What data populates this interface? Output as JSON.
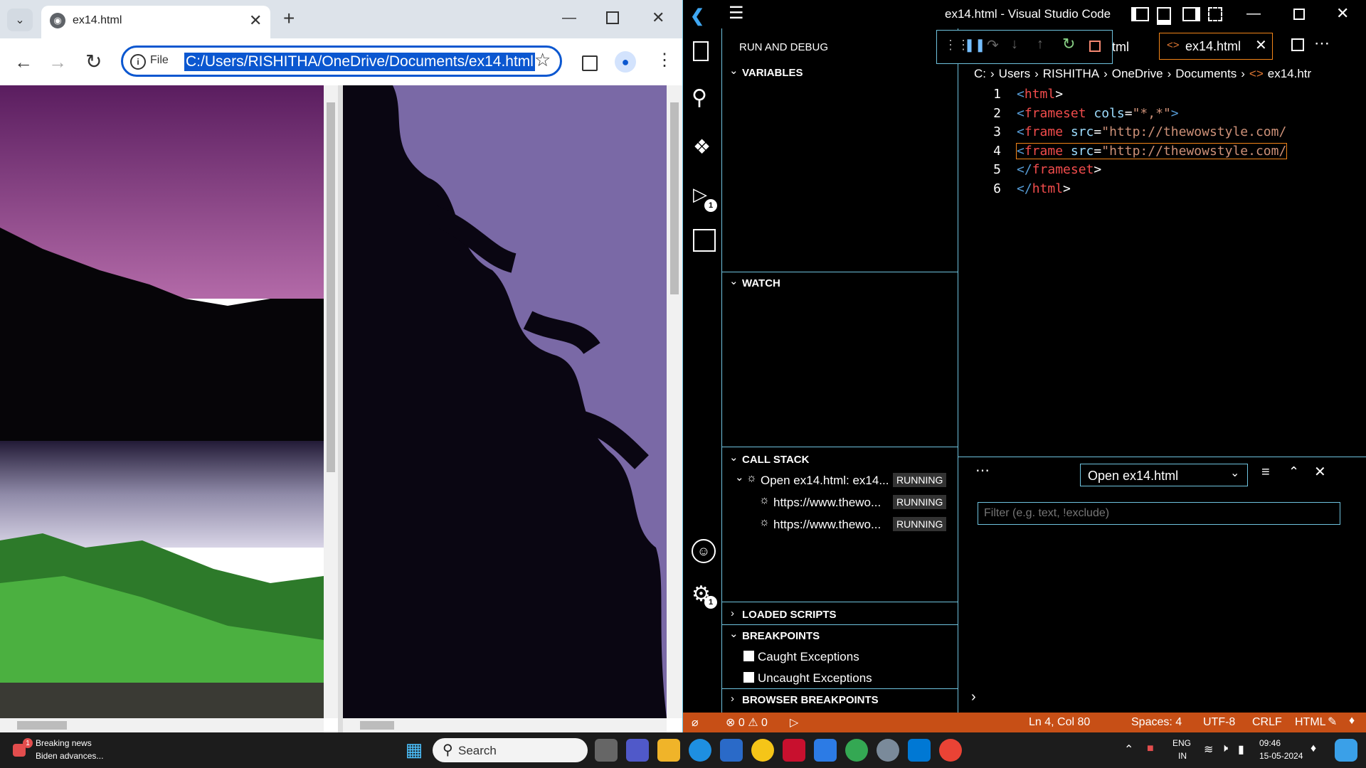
{
  "browser": {
    "tab_title": "ex14.html",
    "address_scheme_label": "File",
    "url": "C:/Users/RISHITHA/OneDrive/Documents/ex14.html"
  },
  "vscode": {
    "window_title": "ex14.html - Visual Studio Code",
    "sidebar_title": "RUN AND DEBUG",
    "tabs": [
      {
        "label": "ml.html"
      },
      {
        "label": "ex14.html"
      }
    ],
    "breadcrumb": [
      "C:",
      "Users",
      "RISHITHA",
      "OneDrive",
      "Documents",
      "ex14.htr"
    ],
    "sections": {
      "variables": "VARIABLES",
      "watch": "WATCH",
      "call_stack": "CALL STACK",
      "loaded_scripts": "LOADED SCRIPTS",
      "breakpoints": "BREAKPOINTS",
      "browser_breakpoints": "BROWSER BREAKPOINTS"
    },
    "call_stack": [
      {
        "label": "Open ex14.html: ex14...",
        "status": "RUNNING"
      },
      {
        "label": "https://www.thewo...",
        "status": "RUNNING"
      },
      {
        "label": "https://www.thewo...",
        "status": "RUNNING"
      }
    ],
    "breakpoints": [
      {
        "label": "Caught Exceptions",
        "checked": false
      },
      {
        "label": "Uncaught Exceptions",
        "checked": false
      }
    ],
    "code_lines": [
      {
        "num": "1",
        "open": "<",
        "el": "html",
        "rest": ">",
        "attr": "",
        "eq": "",
        "str": "",
        "close": ""
      },
      {
        "num": "2",
        "open": "<",
        "el": "frameset",
        "rest": " ",
        "attr": "cols",
        "eq": "=",
        "str": "\"*,*\"",
        "close": ">"
      },
      {
        "num": "3",
        "open": "<",
        "el": "frame",
        "rest": " ",
        "attr": "src",
        "eq": "=",
        "str": "\"http://thewowstyle.com/",
        "close": ""
      },
      {
        "num": "4",
        "open": "<",
        "el": "frame",
        "rest": " ",
        "attr": "src",
        "eq": "=",
        "str": "\"http://thewowstyle.com/",
        "close": ""
      },
      {
        "num": "5",
        "open": "</",
        "el": "frameset",
        "rest": ">",
        "attr": "",
        "eq": "",
        "str": "",
        "close": ""
      },
      {
        "num": "6",
        "open": "</",
        "el": "html",
        "rest": ">",
        "attr": "",
        "eq": "",
        "str": "",
        "close": ""
      }
    ],
    "panel": {
      "select_value": "Open ex14.html",
      "filter_placeholder": "Filter (e.g. text, !exclude)"
    },
    "status": {
      "errors": "0",
      "warnings": "0",
      "position": "Ln 4, Col 80",
      "spaces": "Spaces: 4",
      "encoding": "UTF-8",
      "eol": "CRLF",
      "language": "HTML"
    },
    "activity_badges": {
      "debug": "1",
      "settings": "1"
    }
  },
  "taskbar": {
    "news_title": "Breaking news",
    "news_subtitle": "Biden advances...",
    "news_badge": "1",
    "search_label": "Search",
    "lang_top": "ENG",
    "lang_bottom": "IN",
    "time": "09:46",
    "date": "15-05-2024"
  }
}
